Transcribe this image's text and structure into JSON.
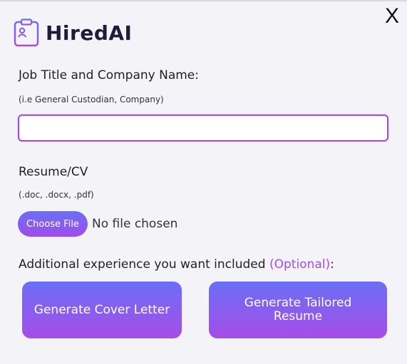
{
  "close_label": "X",
  "brand": {
    "name": "HiredAI",
    "icon": "resume-clipboard-icon"
  },
  "job_field": {
    "label": "Job Title and Company Name:",
    "hint": "(i.e General Custodian, Company)",
    "value": ""
  },
  "resume_field": {
    "label": "Resume/CV",
    "hint": "(.doc, .docx, .pdf)",
    "choose_label": "Choose File",
    "status": "No file chosen"
  },
  "additional": {
    "text": "Additional experience you want included ",
    "optional": "(Optional)",
    "suffix": ":"
  },
  "buttons": {
    "cover_letter": "Generate Cover Letter",
    "tailored_resume": "Generate Tailored Resume"
  },
  "colors": {
    "accent": "#a24de8",
    "gradient_top": "#6a6ff6",
    "gradient_bottom": "#a64de8"
  }
}
